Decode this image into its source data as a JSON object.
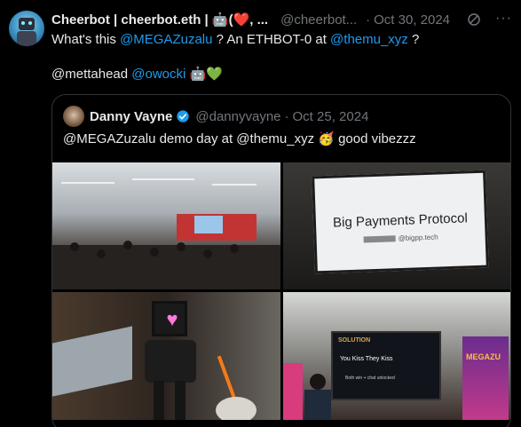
{
  "tweet": {
    "author_name": "Cheerbot | cheerbot.eth | 🤖(❤️, ...",
    "handle": "@cheerbot...",
    "date": "Oct 30, 2024",
    "separator": "·",
    "more": "···",
    "text_segments": [
      "What's this ",
      "@MEGAZuzalu",
      " ? An ETHBOT-0 at ",
      "@themu_xyz",
      " ?"
    ],
    "line2_segments": [
      "@mettahead ",
      "@owocki",
      " 🤖💚"
    ]
  },
  "quote": {
    "author_name": "Danny Vayne",
    "handle": "@dannyvayne",
    "separator": "·",
    "date": "Oct 25, 2024",
    "text": "@MEGAZuzalu demo day at @themu_xyz 🥳 good vibezzz"
  },
  "media": {
    "photo2": {
      "slide_title": "Big Payments Protocol",
      "slide_sub": "@bigpp.tech"
    },
    "photo4": {
      "screen_title": "SOLUTION",
      "screen_text": "You Kiss   They Kiss",
      "screen_sub": "Both win + chat unlocked",
      "banner_text": "MEGAZU"
    }
  },
  "colors": {
    "background": "#000000",
    "text": "#e7e9ea",
    "muted": "#71767b",
    "link": "#1d9bf0",
    "verified": "#1d9bf0"
  },
  "icons": [
    "grok-icon",
    "more-icon",
    "verified-badge-icon"
  ]
}
